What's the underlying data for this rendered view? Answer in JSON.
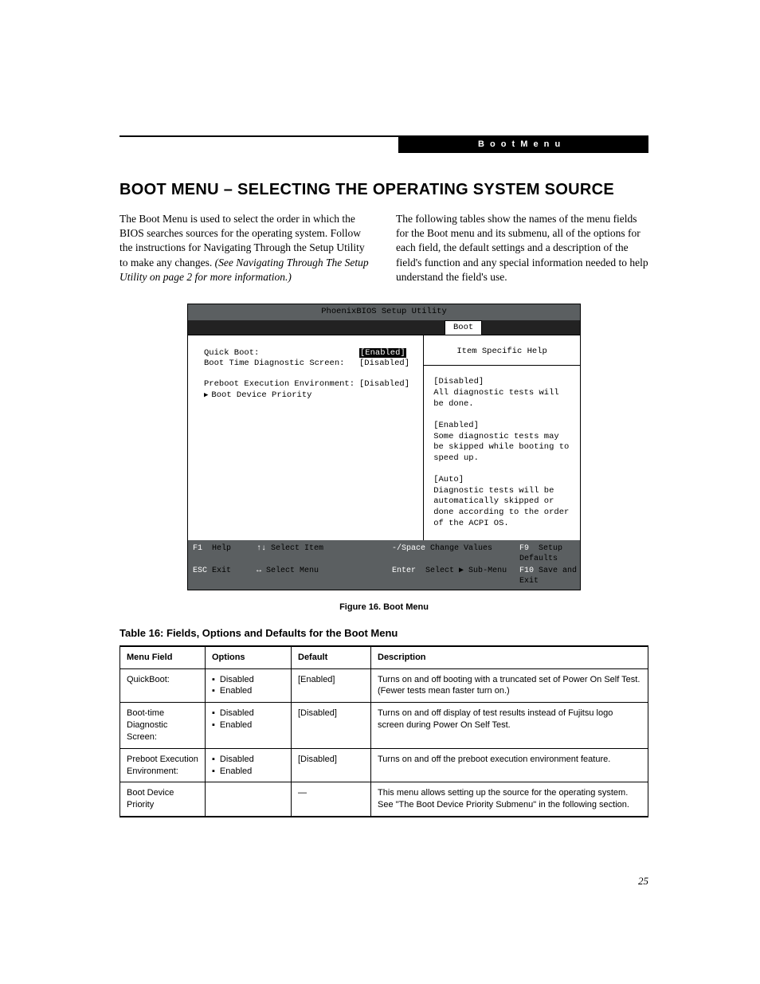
{
  "header": {
    "breadcrumb": "B o o t   M e n u"
  },
  "title": "BOOT MENU – SELECTING THE OPERATING SYSTEM SOURCE",
  "intro": {
    "left_p": "The Boot Menu is used to select the order in which the BIOS searches sources for the operating system. Follow the instructions for Navigating Through the Setup Utility to make any changes. ",
    "left_em": "(See Navigating Through The Setup Utility on page 2 for more information.)",
    "right_p": "The following tables show the names of the menu fields for the Boot menu and its submenu, all of the options for each field, the default settings and a description of the field's function and any special information needed to help understand the field's use."
  },
  "bios": {
    "title": "PhoenixBIOS Setup Utility",
    "tab": "Boot",
    "rows": [
      {
        "label": "Quick Boot:",
        "value": "[Enabled]",
        "selected": true
      },
      {
        "label": "Boot Time Diagnostic Screen:",
        "value": "[Disabled]",
        "selected": false
      },
      {
        "label": "",
        "value": "",
        "selected": false
      },
      {
        "label": "Preboot Execution Environment:",
        "value": "[Disabled]",
        "selected": false
      }
    ],
    "submenu": "Boot Device Priority",
    "help_title": "Item Specific Help",
    "help": [
      "[Disabled]",
      "All diagnostic tests will be done.",
      "",
      "[Enabled]",
      "Some diagnostic tests may be skipped while booting to speed up.",
      "",
      "[Auto]",
      "Diagnostic tests will be automatically skipped or done according to the order of the ACPI OS."
    ],
    "foot": {
      "f1": "F1",
      "help": "Help",
      "updown": "↑↓",
      "select_item": "Select Item",
      "minus_space": "-/Space",
      "change_values": "Change Values",
      "f9": "F9",
      "setup_defaults": "Setup Defaults",
      "esc": "ESC",
      "exit": "Exit",
      "leftright": "↔",
      "select_menu": "Select Menu",
      "enter": "Enter",
      "select_sub": "Select ▶ Sub-Menu",
      "f10": "F10",
      "save_exit": "Save and Exit"
    }
  },
  "figure_caption": "Figure 16.  Boot Menu",
  "table_title": "Table 16: Fields, Options and Defaults for the Boot Menu",
  "table": {
    "headers": [
      "Menu Field",
      "Options",
      "Default",
      "Description"
    ],
    "rows": [
      {
        "field": "QuickBoot:",
        "options": [
          "Disabled",
          "Enabled"
        ],
        "def": "[Enabled]",
        "desc": "Turns on and off booting with a truncated set of Power On Self Test. (Fewer tests mean faster turn on.)"
      },
      {
        "field": "Boot-time Diagnostic Screen:",
        "options": [
          "Disabled",
          "Enabled"
        ],
        "def": "[Disabled]",
        "desc": "Turns on and off display of test results instead of Fujitsu logo screen during Power On Self Test."
      },
      {
        "field": "Preboot Execution Environment:",
        "options": [
          "Disabled",
          "Enabled"
        ],
        "def": "[Disabled]",
        "desc": "Turns on and off the preboot execution environment feature."
      },
      {
        "field": "Boot Device Priority",
        "options": [],
        "def": "—",
        "desc": "This menu allows setting up the source for the operating system. See \"The Boot Device Priority Submenu\" in the following section."
      }
    ]
  },
  "page_number": "25"
}
